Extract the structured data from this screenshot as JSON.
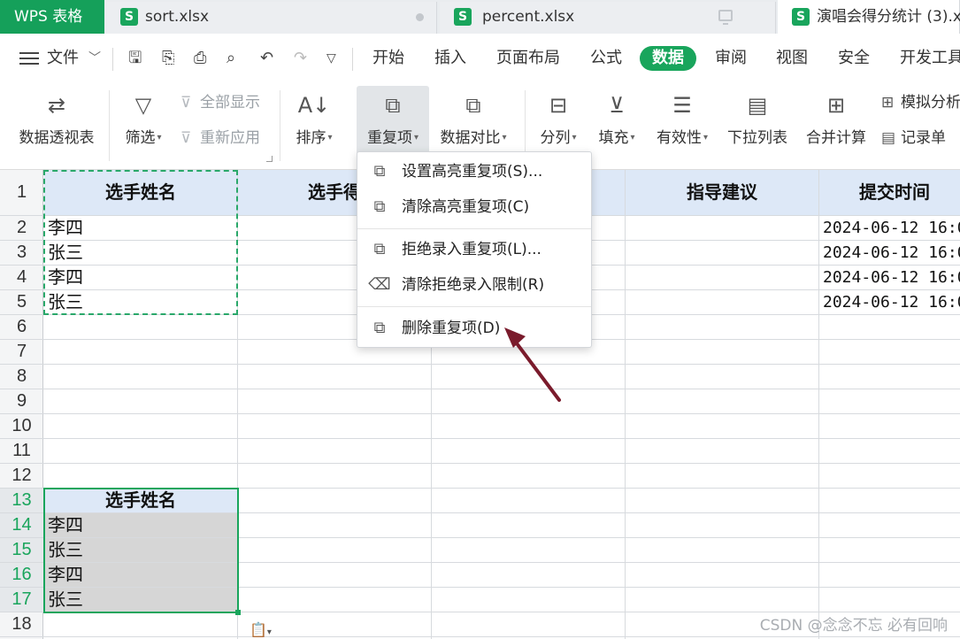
{
  "tabs": {
    "app": "WPS 表格",
    "items": [
      {
        "label": "sort.xlsx"
      },
      {
        "label": "percent.xlsx"
      },
      {
        "label": "演唱会得分统计 (3).x"
      }
    ]
  },
  "menubar": {
    "file": "文件",
    "tabs": [
      "开始",
      "插入",
      "页面布局",
      "公式",
      "数据",
      "审阅",
      "视图",
      "安全",
      "开发工具"
    ]
  },
  "ribbon": {
    "pivot": "数据透视表",
    "filter": "筛选",
    "show_all": "全部显示",
    "reapply": "重新应用",
    "sort": "排序",
    "duplicates": "重复项",
    "compare": "数据对比",
    "split": "分列",
    "fill": "填充",
    "validity": "有效性",
    "dropdown_list": "下拉列表",
    "consolidate": "合并计算",
    "simulate": "模拟分析",
    "records": "记录单"
  },
  "grid": {
    "row_numbers": [
      "1",
      "2",
      "3",
      "4",
      "5",
      "6",
      "7",
      "8",
      "9",
      "10",
      "11",
      "12",
      "13",
      "14",
      "15",
      "16",
      "17",
      "18"
    ],
    "headers": {
      "a": "选手姓名",
      "b": "选手得",
      "d": "指导建议",
      "e": "提交时间"
    },
    "col_a": [
      "李四",
      "张三",
      "李四",
      "张三"
    ],
    "col_e": [
      "2024-06-12 16:0",
      "2024-06-12 16:0",
      "2024-06-12 16:0",
      "2024-06-12 16:0"
    ],
    "copy_header": "选手姓名",
    "copy_rows": [
      "李四",
      "张三",
      "李四",
      "张三"
    ]
  },
  "dropdown": {
    "items": [
      "设置高亮重复项(S)...",
      "清除高亮重复项(C)",
      "拒绝录入重复项(L)...",
      "清除拒绝录入限制(R)",
      "删除重复项(D)"
    ]
  },
  "watermark": "CSDN @念念不忘  必有回响",
  "colors": {
    "accent": "#19a55c",
    "header_fill": "#dde8f7",
    "arrow": "#7a1b2c"
  }
}
